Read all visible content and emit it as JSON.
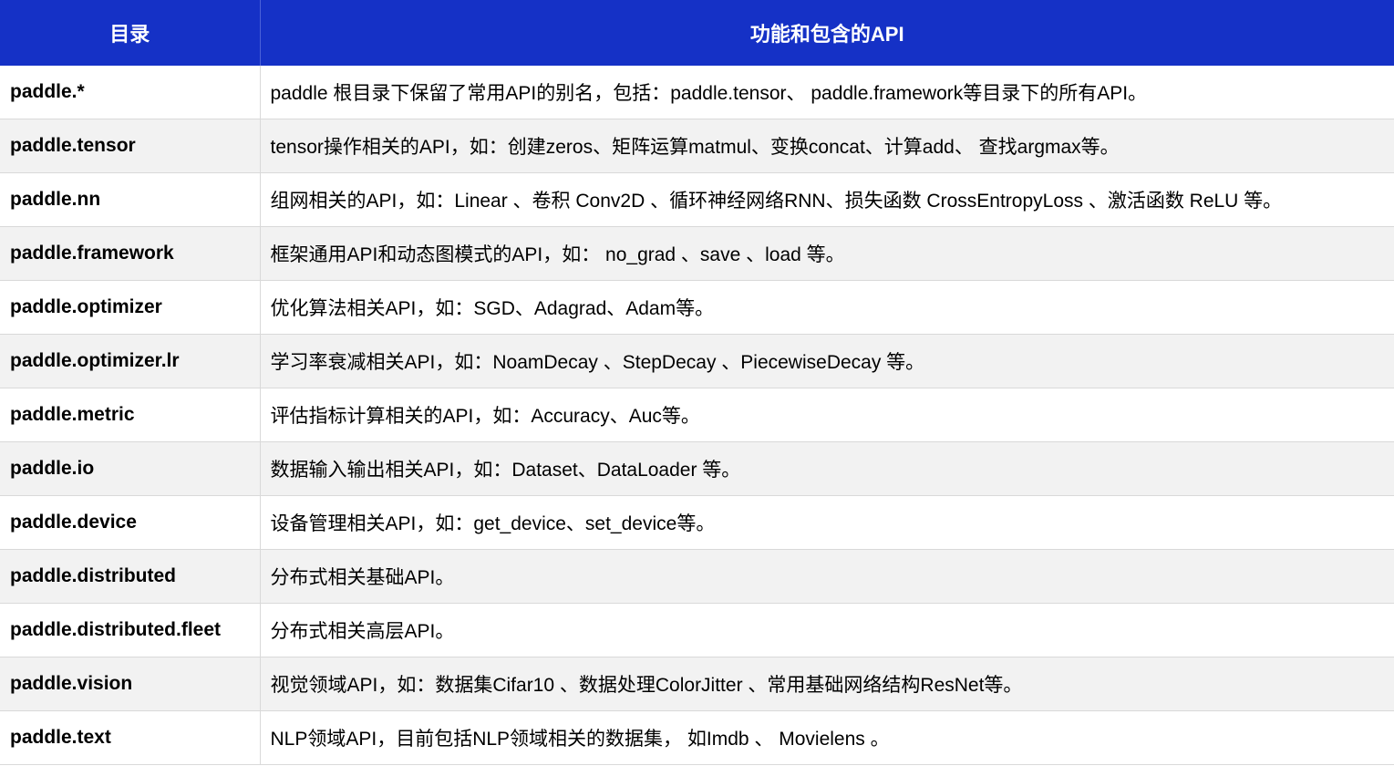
{
  "header": {
    "col_directory": "目录",
    "col_description": "功能和包含的API"
  },
  "rows": [
    {
      "directory": "paddle.*",
      "description": "paddle 根目录下保留了常用API的别名，包括：paddle.tensor、 paddle.framework等目录下的所有API。"
    },
    {
      "directory": "paddle.tensor",
      "description": "tensor操作相关的API，如：创建zeros、矩阵运算matmul、变换concat、计算add、 查找argmax等。"
    },
    {
      "directory": "paddle.nn",
      "description": "组网相关的API，如：Linear 、卷积 Conv2D 、循环神经网络RNN、损失函数 CrossEntropyLoss 、激活函数 ReLU 等。"
    },
    {
      "directory": "paddle.framework",
      "description": "框架通用API和动态图模式的API，如： no_grad 、save 、load 等。"
    },
    {
      "directory": "paddle.optimizer",
      "description": "优化算法相关API，如：SGD、Adagrad、Adam等。"
    },
    {
      "directory": "paddle.optimizer.lr",
      "description": "学习率衰减相关API，如：NoamDecay 、StepDecay 、PiecewiseDecay 等。"
    },
    {
      "directory": "paddle.metric",
      "description": "评估指标计算相关的API，如：Accuracy、Auc等。"
    },
    {
      "directory": "paddle.io",
      "description": "数据输入输出相关API，如：Dataset、DataLoader 等。"
    },
    {
      "directory": "paddle.device",
      "description": "设备管理相关API，如：get_device、set_device等。"
    },
    {
      "directory": "paddle.distributed",
      "description": "分布式相关基础API。"
    },
    {
      "directory": "paddle.distributed.fleet",
      "description": "分布式相关高层API。"
    },
    {
      "directory": "paddle.vision",
      "description": "视觉领域API，如：数据集Cifar10 、数据处理ColorJitter 、常用基础网络结构ResNet等。"
    },
    {
      "directory": "paddle.text",
      "description": "NLP领域API，目前包括NLP领域相关的数据集， 如Imdb 、 Movielens 。"
    }
  ]
}
